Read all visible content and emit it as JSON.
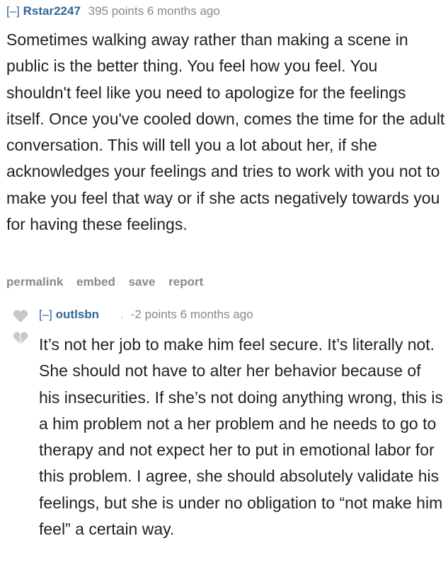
{
  "comment1": {
    "toggle": "[–]",
    "author": "Rstar2247",
    "meta": "395 points 6 months ago",
    "body": "Sometimes walking away rather than making a scene in public is the better thing. You feel how you feel. You shouldn't feel like you need to apologize for the feelings itself. Once you've cooled down, comes the time for the adult conversation. This will tell you a lot about her, if she acknowledges your feelings and tries to work with you not to make you feel that way or if she acts negatively towards you for having these feelings.",
    "actions": {
      "permalink": "permalink",
      "embed": "embed",
      "save": "save",
      "report": "report"
    }
  },
  "comment2": {
    "toggle": "[–]",
    "author": "outlsbn",
    "mark": "،",
    "meta": "-2 points 6 months ago",
    "body": "It’s not her job to make him feel secure. It’s literally not. She should not have to alter her behavior because of his insecurities. If she’s not doing anything wrong, this is a him problem not a her problem and he needs to go to therapy and not expect her to put in emotional labor for this problem. I agree, she should absolutely validate his feelings, but she is under no obligation to “not make him feel” a certain way."
  },
  "icons": {
    "upvote": "heart-upvote-icon",
    "downvote": "broken-heart-downvote-icon"
  },
  "colors": {
    "author": "#336699",
    "meta": "#888888",
    "body": "#222222",
    "vote": "#c8c8c8"
  }
}
